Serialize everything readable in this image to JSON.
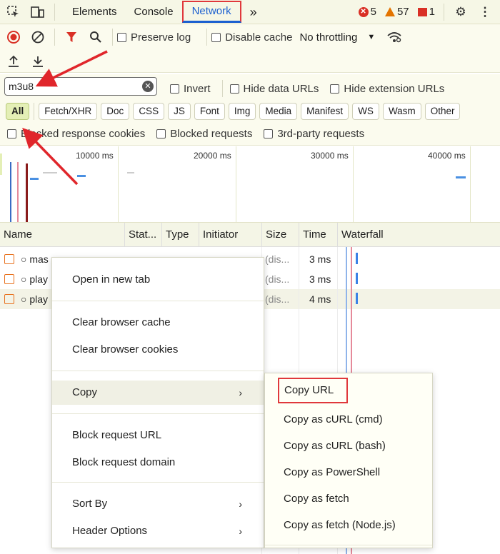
{
  "tabs": [
    "Elements",
    "Console",
    "Network"
  ],
  "more_tabs": "»",
  "errors": "5",
  "warnings": "57",
  "issues": "1",
  "toolbar": {
    "preserve_log": "Preserve log",
    "disable_cache": "Disable cache",
    "throttling": "No throttling"
  },
  "filter": {
    "value": "m3u8",
    "invert": "Invert",
    "hide_data_urls": "Hide data URLs",
    "hide_extension_urls": "Hide extension URLs"
  },
  "types": [
    "All",
    "Fetch/XHR",
    "Doc",
    "CSS",
    "JS",
    "Font",
    "Img",
    "Media",
    "Manifest",
    "WS",
    "Wasm",
    "Other"
  ],
  "cookies": {
    "blocked_response": "Blocked response cookies",
    "blocked_requests": "Blocked requests",
    "third_party": "3rd-party requests"
  },
  "timeline": [
    "10000 ms",
    "20000 ms",
    "30000 ms",
    "40000 ms"
  ],
  "columns": [
    "Name",
    "Stat...",
    "Type",
    "Initiator",
    "Size",
    "Time",
    "Waterfall"
  ],
  "rows": [
    {
      "name": "mas",
      "size": "(dis...",
      "time": "3 ms"
    },
    {
      "name": "play",
      "size": "(dis...",
      "time": "3 ms"
    },
    {
      "name": "play",
      "size": "(dis...",
      "time": "4 ms"
    }
  ],
  "context_menu": {
    "open_new_tab": "Open in new tab",
    "clear_cache": "Clear browser cache",
    "clear_cookies": "Clear browser cookies",
    "copy": "Copy",
    "block_url": "Block request URL",
    "block_domain": "Block request domain",
    "sort_by": "Sort By",
    "header_options": "Header Options"
  },
  "copy_submenu": [
    "Copy URL",
    "Copy as cURL (cmd)",
    "Copy as cURL (bash)",
    "Copy as PowerShell",
    "Copy as fetch",
    "Copy as fetch (Node.js)"
  ]
}
